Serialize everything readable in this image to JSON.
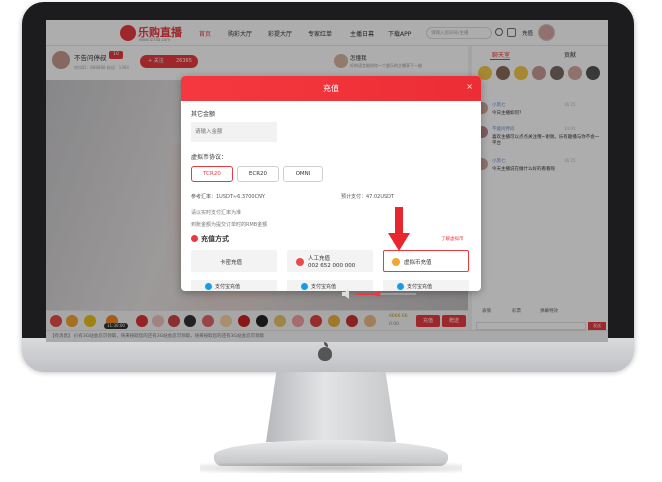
{
  "topbar": {
    "logo_text": "乐购直播",
    "logo_sub": "www.lz7aa.com",
    "nav": [
      {
        "label": "首页",
        "active": true
      },
      {
        "label": "购彩大厅",
        "active": false
      },
      {
        "label": "彩提大厅",
        "active": false
      },
      {
        "label": "专家红单",
        "active": false
      },
      {
        "label": "主播日幕",
        "active": false
      },
      {
        "label": "下载APP",
        "active": false
      }
    ],
    "search_placeholder": "请输入房间号/主播",
    "recharge_label": "充值"
  },
  "host": {
    "name": "不告问停叔",
    "level": "10",
    "meta": "房间ID：888888    粉丝：1384",
    "follow_label": "+ 关注",
    "follow_count": "26365",
    "room_name": "怎懂我",
    "room_desc": "好的语言能给你一个超乐的主播享下一趟"
  },
  "giftbar": {
    "timer": "11:30:00",
    "coins": "6666.66",
    "coins_sub": "0.00",
    "recharge_label": "充值",
    "send_label": "赠送"
  },
  "notice": "【有消息】 价有3G站会忍可领取，快来按取您的还有3G站会忍可领取，快来按取您的还有3G站会忍可领取",
  "chat": {
    "tabs": [
      "聊天室",
      "贡献"
    ],
    "messages": [
      {
        "name": "小黑七",
        "time": "16:25",
        "text": "今日主播如何？"
      },
      {
        "name": "不能问传问",
        "time": "14:01",
        "text": "喜欢主播可以点点关注哦~谢谢。乐有趣播与你不会一平台"
      },
      {
        "name": "小黑七",
        "time": "16:25",
        "text": "今天主播说在做什么好的看看呢"
      }
    ],
    "tools": [
      "表情",
      "彩票",
      "弹幕特效"
    ],
    "send_label": "发送"
  },
  "modal": {
    "title": "充值",
    "close": "×",
    "other_amount_label": "其它金额",
    "amount_placeholder": "请输入金额",
    "protocol_label": "虚拟币协议：",
    "protocols": [
      {
        "label": "TCR20",
        "selected": true
      },
      {
        "label": "ECR20",
        "selected": false
      },
      {
        "label": "OMNI",
        "selected": false
      }
    ],
    "rate": "参考汇率：1USDT≈6.3700CNY",
    "estimate": "预计支付：47.02USDT",
    "note1": "请以实时支付汇率为准",
    "note2": "到账金额为提交订单时的RMB金额",
    "method_title": "充值方式",
    "tutorial": "了解虚拟币",
    "methods": [
      {
        "label": "卡密充值",
        "sub": "",
        "selected": false
      },
      {
        "label": "人工充值",
        "sub": "002 652 000 000",
        "selected": false
      },
      {
        "label": "虚拟币充值",
        "sub": "",
        "selected": true
      }
    ],
    "methods_row2": [
      "支付宝充值",
      "支付宝充值",
      "支付宝充值"
    ]
  },
  "colors": {
    "accent": "#e83a3f",
    "alipay": "#1a9be8"
  }
}
